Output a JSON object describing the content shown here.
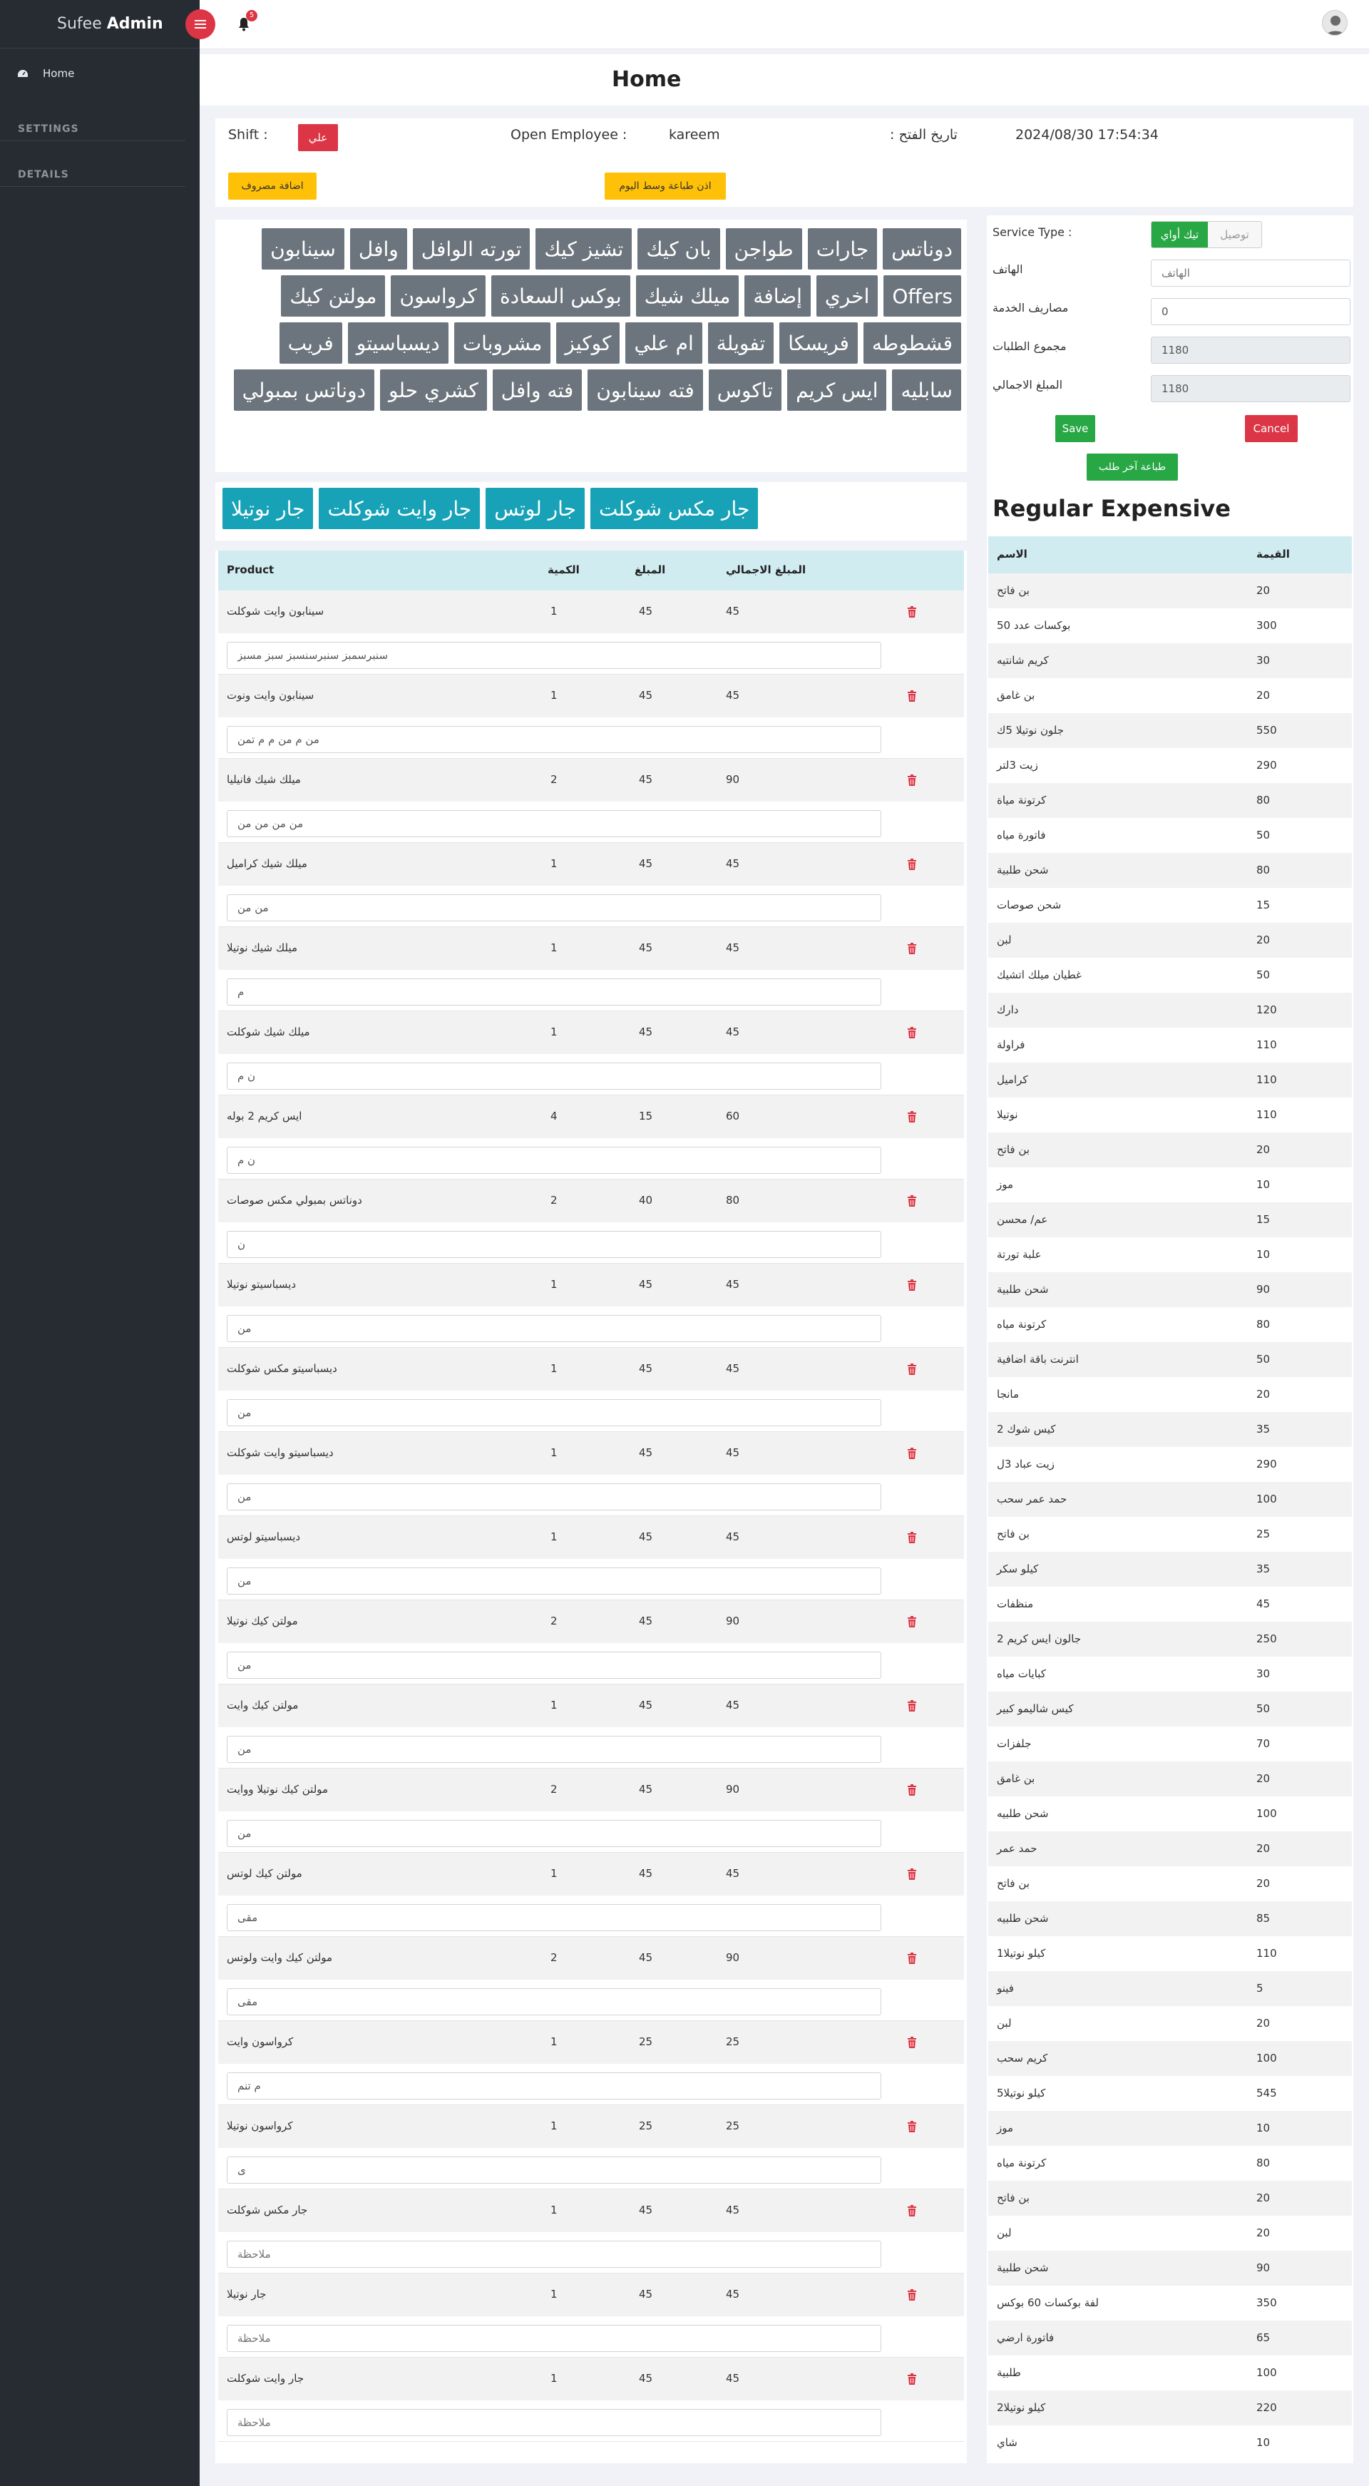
{
  "brand": {
    "part1": "Sufee",
    "part2": "Admin"
  },
  "sidebar": {
    "home_label": "Home",
    "settings_title": "SETTINGS",
    "details_title": "DETAILS"
  },
  "header": {
    "notification_count": "5"
  },
  "page": {
    "title": "Home"
  },
  "shift": {
    "shift_label": "Shift :",
    "shift_value": "علي",
    "open_employee_label": "Open Employee :",
    "open_employee_value": "kareem",
    "open_date_label": ": تاريخ الفتح",
    "open_date_value": "2024/08/30 17:54:34",
    "add_expense_label": "اضافة مصروف",
    "print_mid_day_label": "اذن طباعة وسط اليوم"
  },
  "categories": [
    "دوناتس",
    "جارات",
    "طواجن",
    "بان كيك",
    "تشيز كيك",
    "تورته الوافل",
    "وافل",
    "سينابون",
    "Offers",
    "اخري",
    "إضافة",
    "ميلك شيك",
    "بوكس السعادة",
    "كرواسون",
    "مولتن كيك",
    "قشطوطه",
    "فريسكا",
    "تفويلة",
    "ام علي",
    "كوكيز",
    "مشروبات",
    "ديسباسيتو",
    "فريب",
    "سابليه",
    "ايس كريم",
    "تاكوس",
    "فته سينابون",
    "فته وافل",
    "كشري حلو",
    "دوناتس بمبولي"
  ],
  "jar_buttons": [
    "جار مكس شوكلت",
    "جار لوتس",
    "جار وايت شوكلت",
    "جار نوتيلا"
  ],
  "order_table": {
    "headers": {
      "product": "Product",
      "qty": "الكمية",
      "price": "المبلغ",
      "total": "المبلغ الاجمالي"
    },
    "rows": [
      {
        "name": "سينابون وايت شوكلت",
        "qty": "1",
        "price": "45",
        "total": "45",
        "note": "سنبرسمبز سنبرسنسبز سبز مسبز",
        "note_placeholder": ""
      },
      {
        "name": "سينابون وايت ونوت",
        "qty": "1",
        "price": "45",
        "total": "45",
        "note": "من م من م م تمن",
        "note_placeholder": ""
      },
      {
        "name": "ميلك شيك فانيليا",
        "qty": "2",
        "price": "45",
        "total": "90",
        "note": "من من من من",
        "note_placeholder": ""
      },
      {
        "name": "ميلك شيك كراميل",
        "qty": "1",
        "price": "45",
        "total": "45",
        "note": "من من",
        "note_placeholder": ""
      },
      {
        "name": "ميلك شيك نوتيلا",
        "qty": "1",
        "price": "45",
        "total": "45",
        "note": "م",
        "note_placeholder": ""
      },
      {
        "name": "ميلك شيك شوكلت",
        "qty": "1",
        "price": "45",
        "total": "45",
        "note": "ن م",
        "note_placeholder": ""
      },
      {
        "name": "ايس كريم 2 بوله",
        "qty": "4",
        "price": "15",
        "total": "60",
        "note": "ن م",
        "note_placeholder": ""
      },
      {
        "name": "دوناتس بمبولي مكس صوصات",
        "qty": "2",
        "price": "40",
        "total": "80",
        "note": "ن",
        "note_placeholder": ""
      },
      {
        "name": "ديسباسيتو نوتيلا",
        "qty": "1",
        "price": "45",
        "total": "45",
        "note": "من",
        "note_placeholder": ""
      },
      {
        "name": "ديسباسيتو مكس شوكلت",
        "qty": "1",
        "price": "45",
        "total": "45",
        "note": "من",
        "note_placeholder": ""
      },
      {
        "name": "ديسباسيتو وايت شوكلت",
        "qty": "1",
        "price": "45",
        "total": "45",
        "note": "من",
        "note_placeholder": ""
      },
      {
        "name": "ديسباسيتو لوتس",
        "qty": "1",
        "price": "45",
        "total": "45",
        "note": "من",
        "note_placeholder": ""
      },
      {
        "name": "مولتن كيك نوتيلا",
        "qty": "2",
        "price": "45",
        "total": "90",
        "note": "من",
        "note_placeholder": ""
      },
      {
        "name": "مولتن كيك وايت",
        "qty": "1",
        "price": "45",
        "total": "45",
        "note": "من",
        "note_placeholder": ""
      },
      {
        "name": "مولتن كيك نوتيلا ووايت",
        "qty": "2",
        "price": "45",
        "total": "90",
        "note": "من",
        "note_placeholder": ""
      },
      {
        "name": "مولتن كيك لوتس",
        "qty": "1",
        "price": "45",
        "total": "45",
        "note": "مقى",
        "note_placeholder": ""
      },
      {
        "name": "مولتن كيك وايت ولوتس",
        "qty": "2",
        "price": "45",
        "total": "90",
        "note": "مقى",
        "note_placeholder": ""
      },
      {
        "name": "كرواسون وايت",
        "qty": "1",
        "price": "25",
        "total": "25",
        "note": "م تنم",
        "note_placeholder": ""
      },
      {
        "name": "كرواسون نوتيلا",
        "qty": "1",
        "price": "25",
        "total": "25",
        "note": "ى",
        "note_placeholder": ""
      },
      {
        "name": "جار مكس شوكلت",
        "qty": "1",
        "price": "45",
        "total": "45",
        "note": "",
        "note_placeholder": "ملاحظة"
      },
      {
        "name": "جار نوتيلا",
        "qty": "1",
        "price": "45",
        "total": "45",
        "note": "",
        "note_placeholder": "ملاحظة"
      },
      {
        "name": "جار وايت شوكلت",
        "qty": "1",
        "price": "45",
        "total": "45",
        "note": "",
        "note_placeholder": "ملاحظة"
      }
    ]
  },
  "service": {
    "type_label": "Service Type :",
    "option_active": "تيك أواي",
    "option_inactive": "توصيل",
    "phone_label": "الهاتف",
    "phone_placeholder": "الهاتف",
    "service_fee_label": "مصاريف الخدمة",
    "service_fee_value": "0",
    "orders_total_label": "مجموع الطلبات",
    "orders_total_value": "1180",
    "grand_total_label": "المبلغ الاجمالي",
    "grand_total_value": "1180",
    "save_label": "Save",
    "cancel_label": "Cancel",
    "print_last_label": "طباعة آخر طلب"
  },
  "expenses": {
    "title": "Regular Expensive",
    "headers": {
      "name": "الاسم",
      "value": "القيمة"
    },
    "rows": [
      {
        "name": "بن فاتح",
        "value": "20"
      },
      {
        "name": "بوكسات عدد 50",
        "value": "300"
      },
      {
        "name": "كريم شانتيه",
        "value": "30"
      },
      {
        "name": "بن غامق",
        "value": "20"
      },
      {
        "name": "جلون نوتيلا 5ك",
        "value": "550"
      },
      {
        "name": "زيت 3لتر",
        "value": "290"
      },
      {
        "name": "كرتونة مياة",
        "value": "80"
      },
      {
        "name": "فاتورة مياه",
        "value": "50"
      },
      {
        "name": "شحن طلبية",
        "value": "80"
      },
      {
        "name": "شحن صوصات",
        "value": "15"
      },
      {
        "name": "لبن",
        "value": "20"
      },
      {
        "name": "غطيان ميلك اتشيك",
        "value": "50"
      },
      {
        "name": "دارك",
        "value": "120"
      },
      {
        "name": "فراولة",
        "value": "110"
      },
      {
        "name": "كراميل",
        "value": "110"
      },
      {
        "name": "نوتيلا",
        "value": "110"
      },
      {
        "name": "بن فاتح",
        "value": "20"
      },
      {
        "name": "موز",
        "value": "10"
      },
      {
        "name": "عم/ محسن",
        "value": "15"
      },
      {
        "name": "علبة تورتة",
        "value": "10"
      },
      {
        "name": "شحن طلبية",
        "value": "90"
      },
      {
        "name": "كرتونة مياه",
        "value": "80"
      },
      {
        "name": "انترنت باقة اضافية",
        "value": "50"
      },
      {
        "name": "مانجا",
        "value": "20"
      },
      {
        "name": "كيس شوك 2",
        "value": "35"
      },
      {
        "name": "زيت عباد 3ل",
        "value": "290"
      },
      {
        "name": "حمد عمر سحب",
        "value": "100"
      },
      {
        "name": "بن فاتح",
        "value": "25"
      },
      {
        "name": "كيلو سكر",
        "value": "35"
      },
      {
        "name": "منظفات",
        "value": "45"
      },
      {
        "name": "جالون ايس كريم 2",
        "value": "250"
      },
      {
        "name": "كبايات مياه",
        "value": "30"
      },
      {
        "name": "كيس شاليمو كبير",
        "value": "50"
      },
      {
        "name": "جلفزات",
        "value": "70"
      },
      {
        "name": "بن غامق",
        "value": "20"
      },
      {
        "name": "شحن طلبيه",
        "value": "100"
      },
      {
        "name": "حمد عمر",
        "value": "20"
      },
      {
        "name": "بن فاتح",
        "value": "20"
      },
      {
        "name": "شحن طلبيه",
        "value": "85"
      },
      {
        "name": "كيلو نوتيلا1",
        "value": "110"
      },
      {
        "name": "فينو",
        "value": "5"
      },
      {
        "name": "لبن",
        "value": "20"
      },
      {
        "name": "كريم سحب",
        "value": "100"
      },
      {
        "name": "كيلو نوتيلا5",
        "value": "545"
      },
      {
        "name": "موز",
        "value": "10"
      },
      {
        "name": "كرتونة مياه",
        "value": "80"
      },
      {
        "name": "بن فاتح",
        "value": "20"
      },
      {
        "name": "لبن",
        "value": "20"
      },
      {
        "name": "شحن طلبية",
        "value": "90"
      },
      {
        "name": "لفة بوكسات 60 بوكس",
        "value": "350"
      },
      {
        "name": "فاتورة ارضي",
        "value": "65"
      },
      {
        "name": "طلبية",
        "value": "100"
      },
      {
        "name": "كيلو نوتيلا2",
        "value": "220"
      },
      {
        "name": "شاي",
        "value": "10"
      }
    ]
  }
}
